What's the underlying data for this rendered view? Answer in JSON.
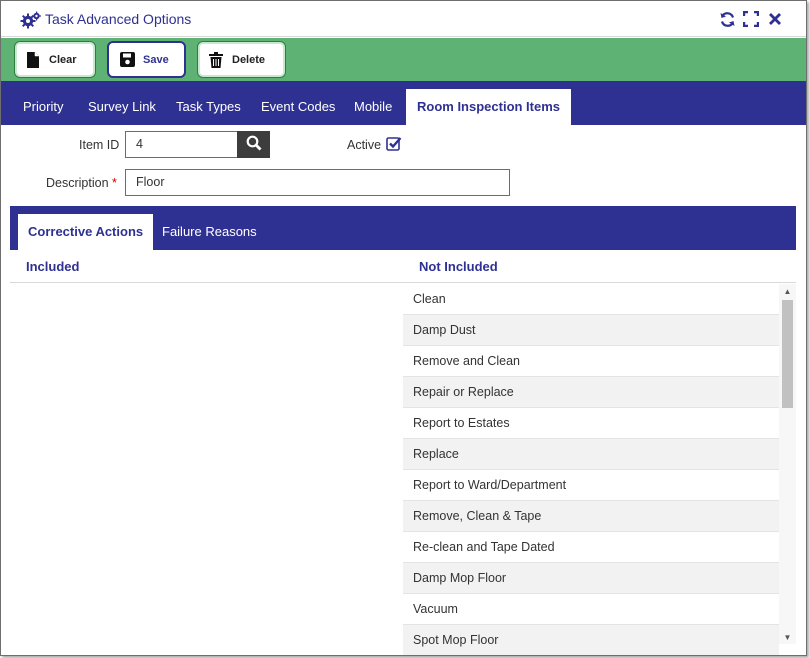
{
  "window": {
    "title": "Task Advanced Options",
    "title_icon": "gears-icon",
    "actions": [
      "refresh-icon",
      "fullscreen-icon",
      "close-icon"
    ]
  },
  "toolbar": {
    "clear_label": "Clear",
    "save_label": "Save",
    "delete_label": "Delete"
  },
  "tabs": [
    {
      "label": "Priority",
      "active": false
    },
    {
      "label": "Survey Link",
      "active": false
    },
    {
      "label": "Task Types",
      "active": false
    },
    {
      "label": "Event Codes",
      "active": false
    },
    {
      "label": "Mobile",
      "active": false
    },
    {
      "label": "Room Inspection Items",
      "active": true
    }
  ],
  "form": {
    "item_id_label": "Item ID",
    "item_id_value": "4",
    "active_label": "Active",
    "active_checked": true,
    "description_label": "Description",
    "description_required_mark": "*",
    "description_value": "Floor"
  },
  "subtabs": [
    {
      "label": "Corrective Actions",
      "active": true
    },
    {
      "label": "Failure Reasons",
      "active": false
    }
  ],
  "columns": {
    "included_header": "Included",
    "not_included_header": "Not Included"
  },
  "not_included_items": [
    "Clean",
    "Damp Dust",
    "Remove and Clean",
    "Repair or Replace",
    "Report to Estates",
    "Replace",
    "Report to Ward/Department",
    "Remove, Clean & Tape",
    "Re-clean and Tape Dated",
    "Damp Mop Floor",
    "Vacuum",
    "Spot Mop Floor"
  ],
  "colors": {
    "brand_navy": "#2f3192",
    "toolbar_green": "#5eb374",
    "required_red": "#cc0000"
  }
}
